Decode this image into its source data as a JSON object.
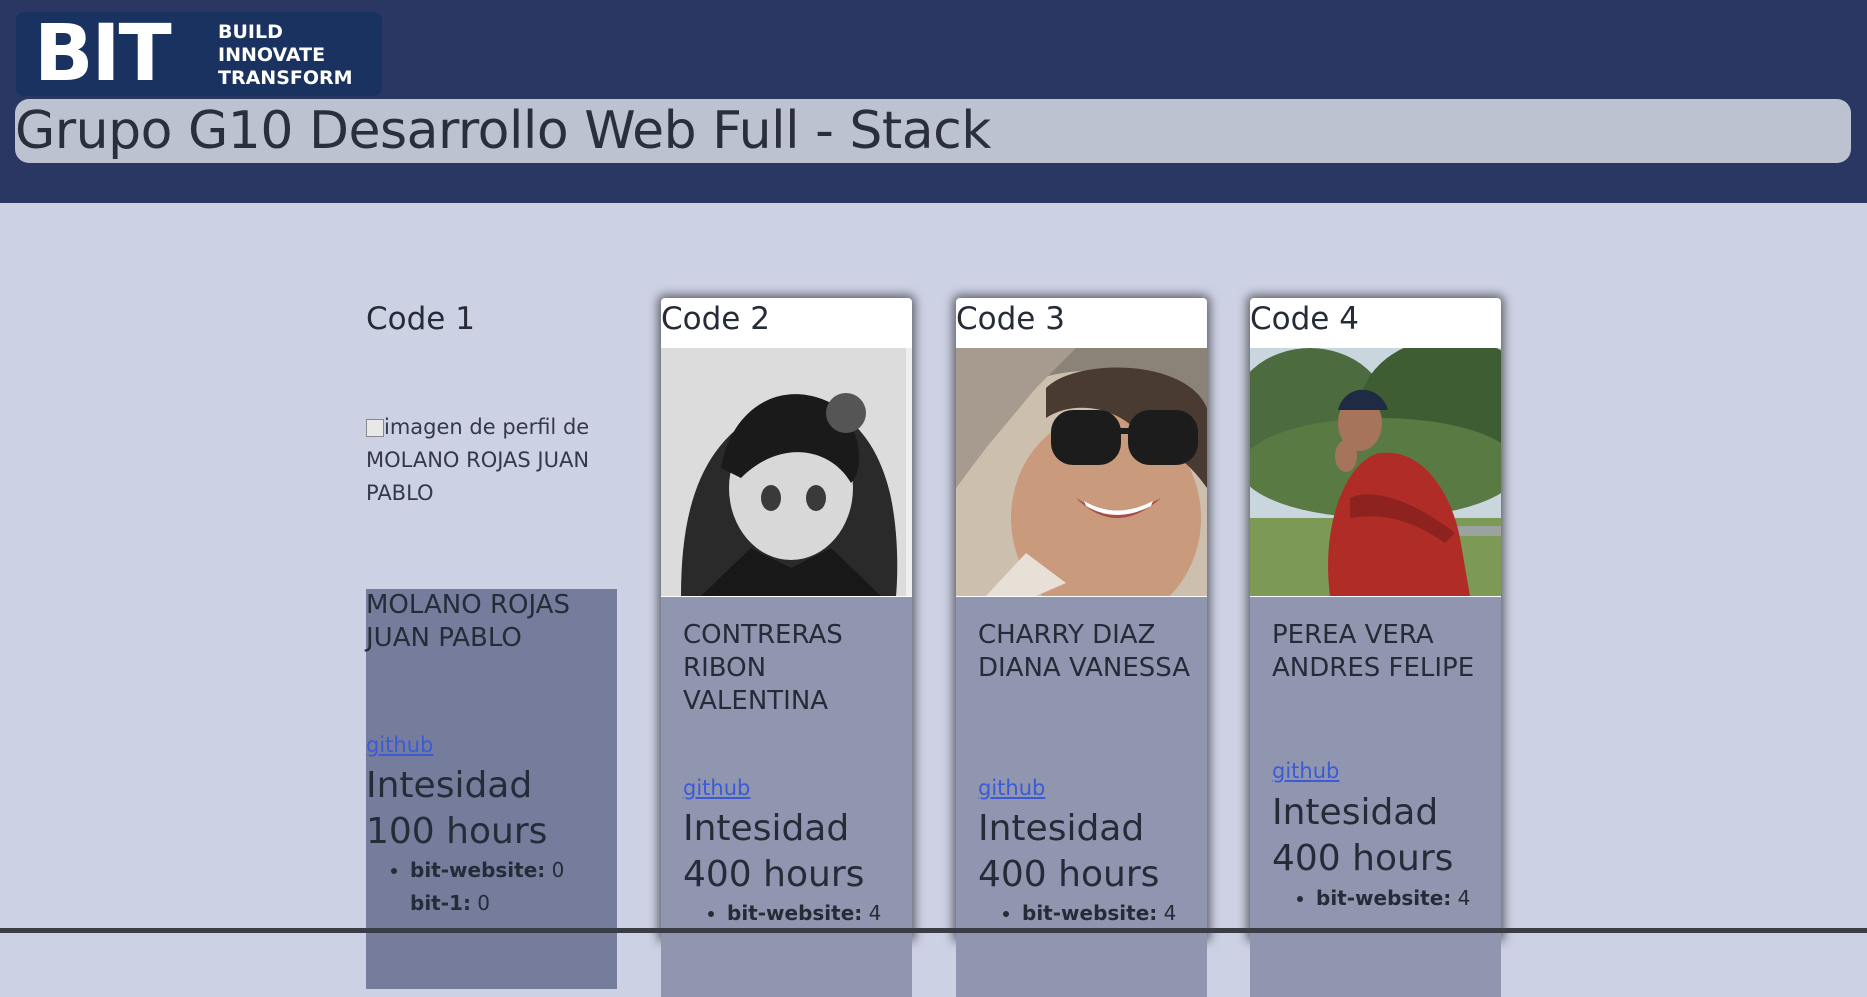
{
  "header": {
    "logo": {
      "big": "BIT",
      "tag": [
        "BUILD",
        "INNOVATE",
        "TRANSFORM"
      ]
    },
    "title": "Grupo G10 Desarrollo Web Full - Stack"
  },
  "cards": [
    {
      "code": "Code 1",
      "image_alt": "imagen de perfil de MOLANO ROJAS JUAN PABLO",
      "name": "MOLANO ROJAS JUAN PABLO",
      "link": "github",
      "hours": "Intesidad 100 hours",
      "stats": [
        {
          "key": "bit-website:",
          "value": " 0"
        },
        {
          "key": "bit-1:",
          "value": " 0"
        }
      ]
    },
    {
      "code": "Code 2",
      "name": "CONTRERAS RIBON VALENTINA",
      "link": "github",
      "hours": "Intesidad 400 hours",
      "stats": [
        {
          "key": "bit-website:",
          "value": " 4"
        }
      ]
    },
    {
      "code": "Code 3",
      "name": "CHARRY DIAZ DIANA VANESSA",
      "link": "github",
      "hours": "Intesidad 400 hours",
      "stats": [
        {
          "key": "bit-website:",
          "value": " 4"
        }
      ]
    },
    {
      "code": "Code 4",
      "name": "PEREA VERA ANDRES FELIPE",
      "link": "github",
      "hours": "Intesidad 400 hours",
      "stats": [
        {
          "key": "bit-website:",
          "value": " 4"
        }
      ]
    }
  ]
}
